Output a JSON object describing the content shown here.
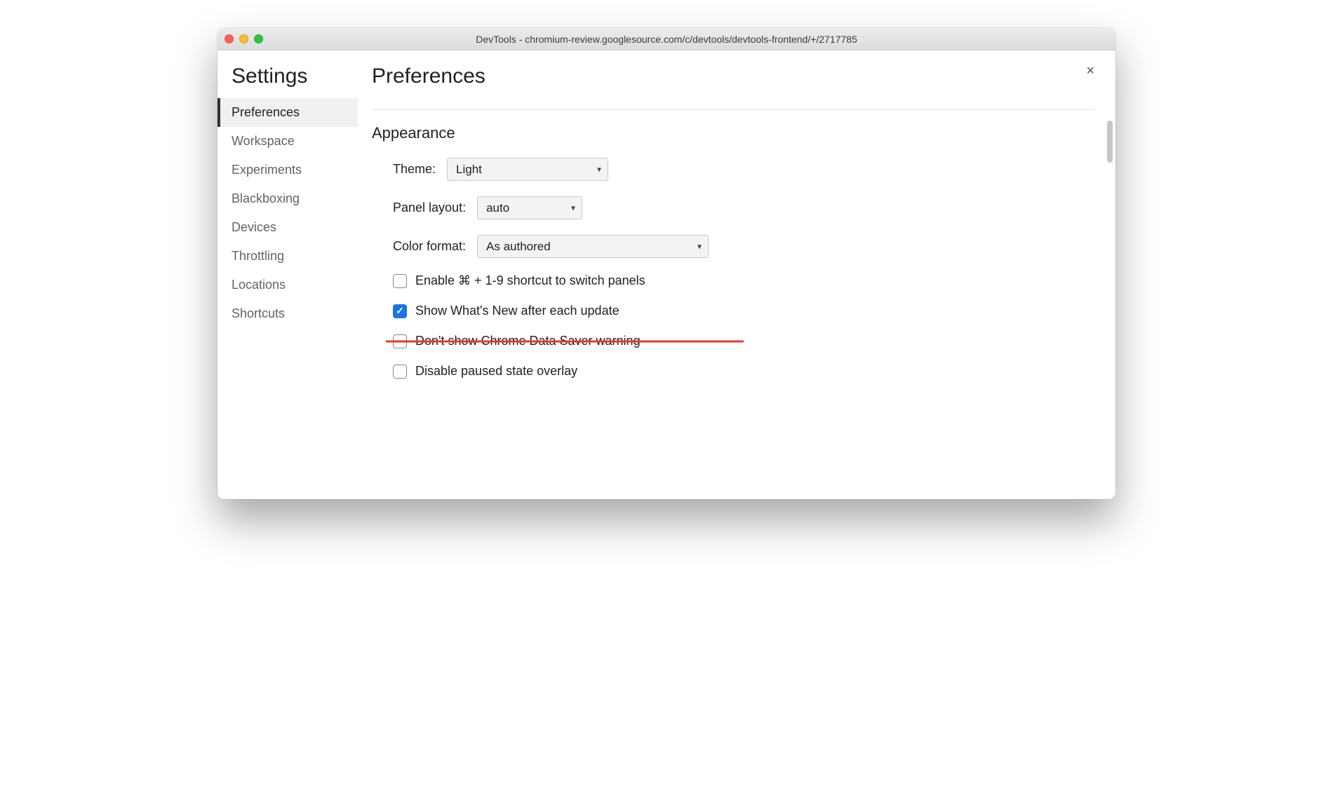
{
  "window": {
    "title": "DevTools - chromium-review.googlesource.com/c/devtools/devtools-frontend/+/2717785"
  },
  "sidebar": {
    "title": "Settings",
    "items": [
      {
        "label": "Preferences",
        "active": true
      },
      {
        "label": "Workspace",
        "active": false
      },
      {
        "label": "Experiments",
        "active": false
      },
      {
        "label": "Blackboxing",
        "active": false
      },
      {
        "label": "Devices",
        "active": false
      },
      {
        "label": "Throttling",
        "active": false
      },
      {
        "label": "Locations",
        "active": false
      },
      {
        "label": "Shortcuts",
        "active": false
      }
    ]
  },
  "main": {
    "title": "Preferences",
    "close_label": "×",
    "appearance": {
      "heading": "Appearance",
      "theme_label": "Theme:",
      "theme_value": "Light",
      "panel_layout_label": "Panel layout:",
      "panel_layout_value": "auto",
      "color_format_label": "Color format:",
      "color_format_value": "As authored",
      "checkboxes": [
        {
          "label": "Enable ⌘ + 1-9 shortcut to switch panels",
          "checked": false,
          "struck": false
        },
        {
          "label": "Show What's New after each update",
          "checked": true,
          "struck": false
        },
        {
          "label": "Don't show Chrome Data Saver warning",
          "checked": false,
          "struck": true
        },
        {
          "label": "Disable paused state overlay",
          "checked": false,
          "struck": false
        }
      ]
    }
  }
}
